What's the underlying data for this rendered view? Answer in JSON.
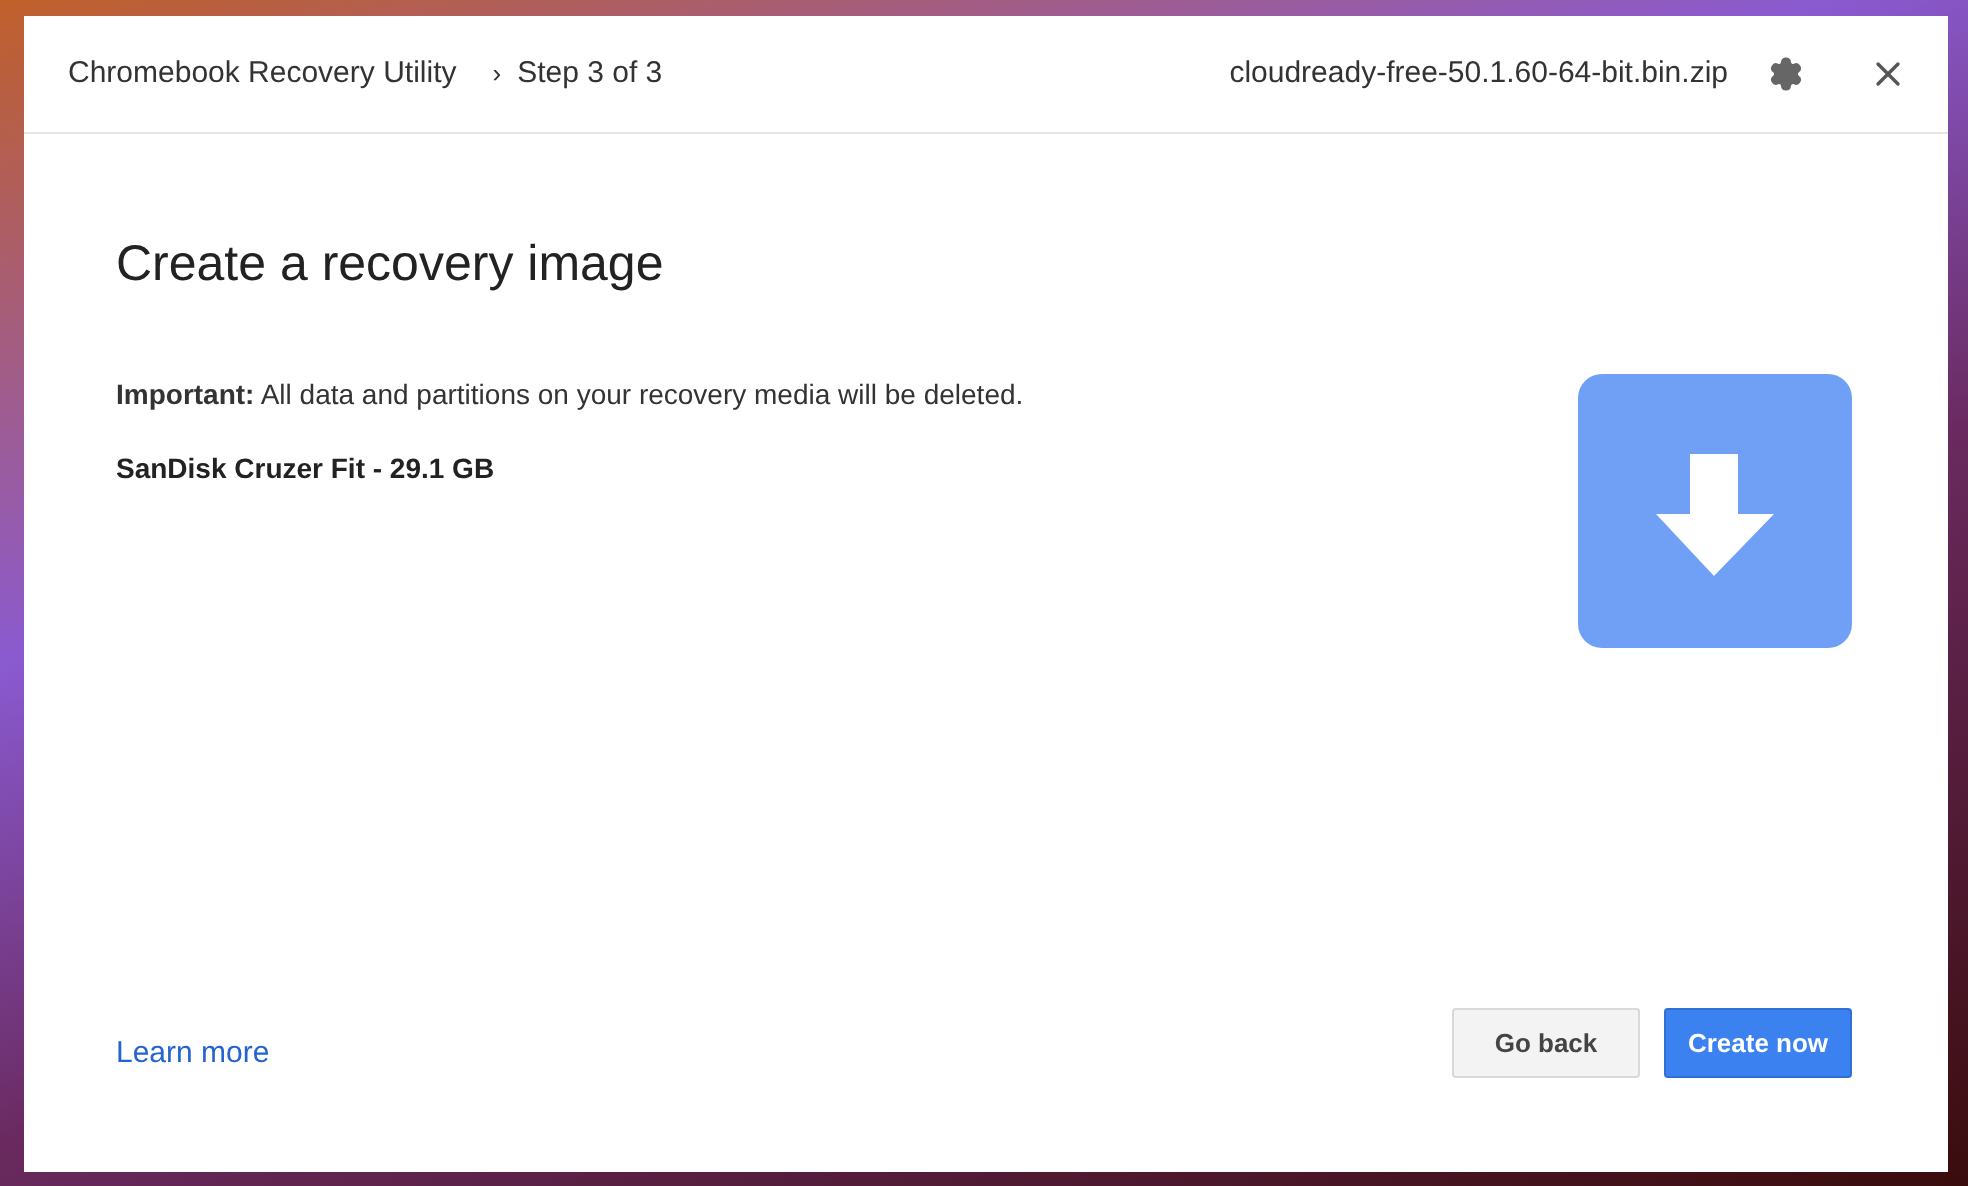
{
  "header": {
    "app_name": "Chromebook Recovery Utility",
    "separator": "›",
    "step": "Step 3 of 3",
    "file_name": "cloudready-free-50.1.60-64-bit.bin.zip"
  },
  "heading": "Create a recovery image",
  "warning": "**Important:** All data and partitions on your recovery media will be deleted.",
  "device": "SanDisk Cruzer Fit - 29.1 GB",
  "learn_more": "Learn more",
  "buttons": [
    {
      "label": "Go back",
      "kind": "secondary"
    },
    {
      "label": "Create now",
      "kind": "primary"
    }
  ]
}
